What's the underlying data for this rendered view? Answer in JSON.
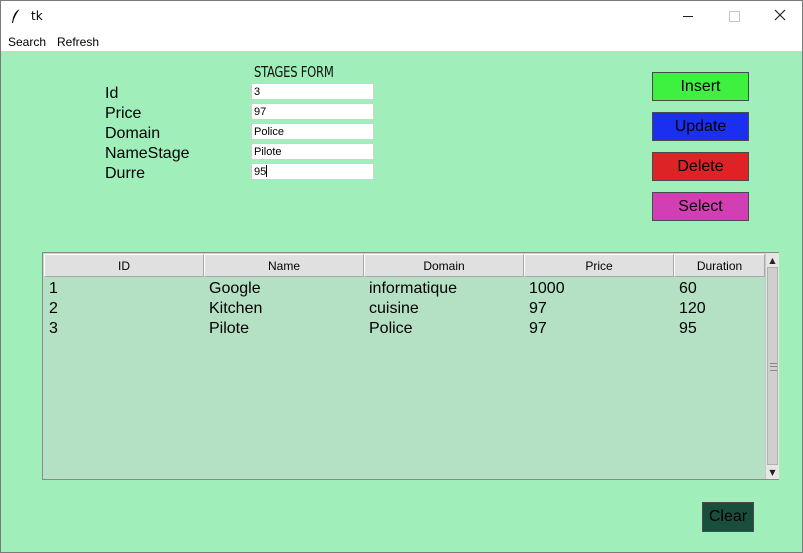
{
  "window": {
    "title": "tk"
  },
  "menu": {
    "search": "Search",
    "refresh": "Refresh"
  },
  "form": {
    "title": "STAGES FORM",
    "fields": [
      {
        "label": "Id",
        "value": "3"
      },
      {
        "label": "Price",
        "value": "97"
      },
      {
        "label": "Domain",
        "value": "Police"
      },
      {
        "label": "NameStage",
        "value": "Pilote"
      },
      {
        "label": "Durre",
        "value": "95"
      }
    ]
  },
  "buttons": {
    "insert": "Insert",
    "update": "Update",
    "delete": "Delete",
    "select": "Select",
    "clear": "Clear"
  },
  "colors": {
    "background": "#a0efbb",
    "insert": "#3ef040",
    "update": "#1b2ff0",
    "delete": "#df2225",
    "select": "#d23fb4",
    "clear": "#1a4e3c",
    "table_bg": "#b4e0c4"
  },
  "table": {
    "columns": [
      "ID",
      "Name",
      "Domain",
      "Price",
      "Duration"
    ],
    "rows": [
      [
        "1",
        "Google",
        "informatique",
        "1000",
        "60"
      ],
      [
        "2",
        "Kitchen",
        "cuisine",
        "97",
        "120"
      ],
      [
        "3",
        "Pilote",
        "Police",
        "97",
        "95"
      ]
    ]
  },
  "icons": {
    "app": "feather-icon",
    "minimize": "minimize-icon",
    "maximize": "maximize-icon",
    "close": "close-icon"
  }
}
